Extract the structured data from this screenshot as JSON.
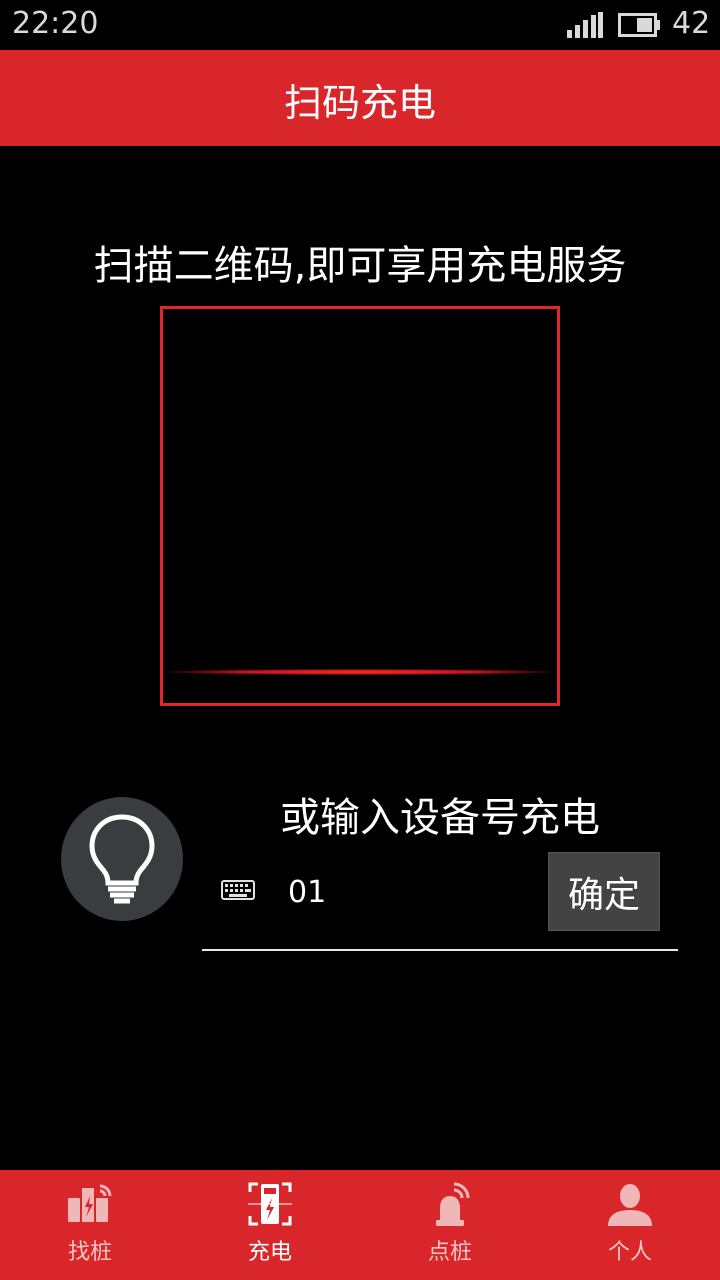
{
  "status_bar": {
    "time": "22:20",
    "battery_level": "42"
  },
  "header": {
    "title": "扫码充电"
  },
  "scan": {
    "tip": "扫描二维码,即可享用充电服务"
  },
  "device": {
    "tip": "或输入设备号充电",
    "input_value": "01",
    "confirm_label": "确定"
  },
  "colors": {
    "brand_red": "#d9262a",
    "scan_frame": "#e3262c"
  },
  "nav": {
    "items": [
      {
        "label": "找桩",
        "icon": "charging-station-icon"
      },
      {
        "label": "充电",
        "icon": "scan-charge-icon"
      },
      {
        "label": "点桩",
        "icon": "alarm-beacon-icon"
      },
      {
        "label": "个人",
        "icon": "user-icon"
      }
    ]
  }
}
